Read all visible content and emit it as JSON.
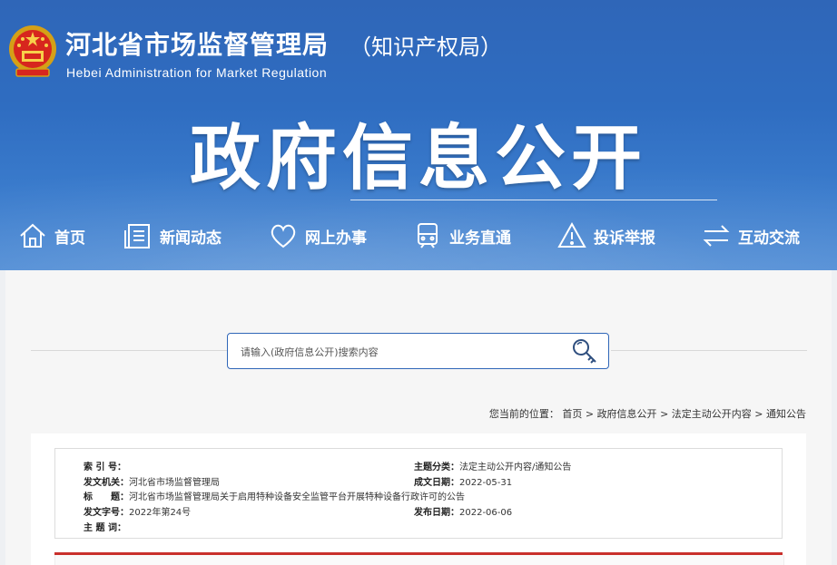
{
  "header": {
    "site_title": "河北省市场监督管理局",
    "site_subtitle": "（知识产权局）",
    "site_title_en": "Hebei Administration for Market Regulation",
    "banner_title": "政府信息公开",
    "emblem_icon": "national-emblem-icon"
  },
  "nav": {
    "items": [
      {
        "label": "首页",
        "icon": "home-icon"
      },
      {
        "label": "新闻动态",
        "icon": "document-list-icon"
      },
      {
        "label": "网上办事",
        "icon": "heart-icon"
      },
      {
        "label": "业务直通",
        "icon": "train-icon"
      },
      {
        "label": "投诉举报",
        "icon": "warning-icon"
      },
      {
        "label": "互动交流",
        "icon": "swap-arrows-icon"
      }
    ]
  },
  "search": {
    "placeholder": "请输入(政府信息公开)搜索内容",
    "button_icon": "search-icon"
  },
  "breadcrumb": {
    "prefix": "您当前的位置：",
    "items": [
      "首页",
      "政府信息公开",
      "法定主动公开内容",
      "通知公告"
    ],
    "separator": ">"
  },
  "info": {
    "index_label": "索 引 号：",
    "index_value": "",
    "category_label": "主题分类：",
    "category_value": "法定主动公开内容/通知公告",
    "issuer_label": "发文机关：",
    "issuer_value": "河北省市场监督管理局",
    "created_label": "成文日期：",
    "created_value": "2022-05-31",
    "title_label": "标　　题：",
    "title_value": "河北省市场监督管理局关于启用特种设备安全监管平台开展特种设备行政许可的公告",
    "docno_label": "发文字号：",
    "docno_value": "2022年第24号",
    "published_label": "发布日期：",
    "published_value": "2022-06-06",
    "keywords_label": "主 题 词：",
    "keywords_value": ""
  },
  "colors": {
    "banner_blue": "#2f66b8",
    "accent_red": "#c9302c"
  }
}
